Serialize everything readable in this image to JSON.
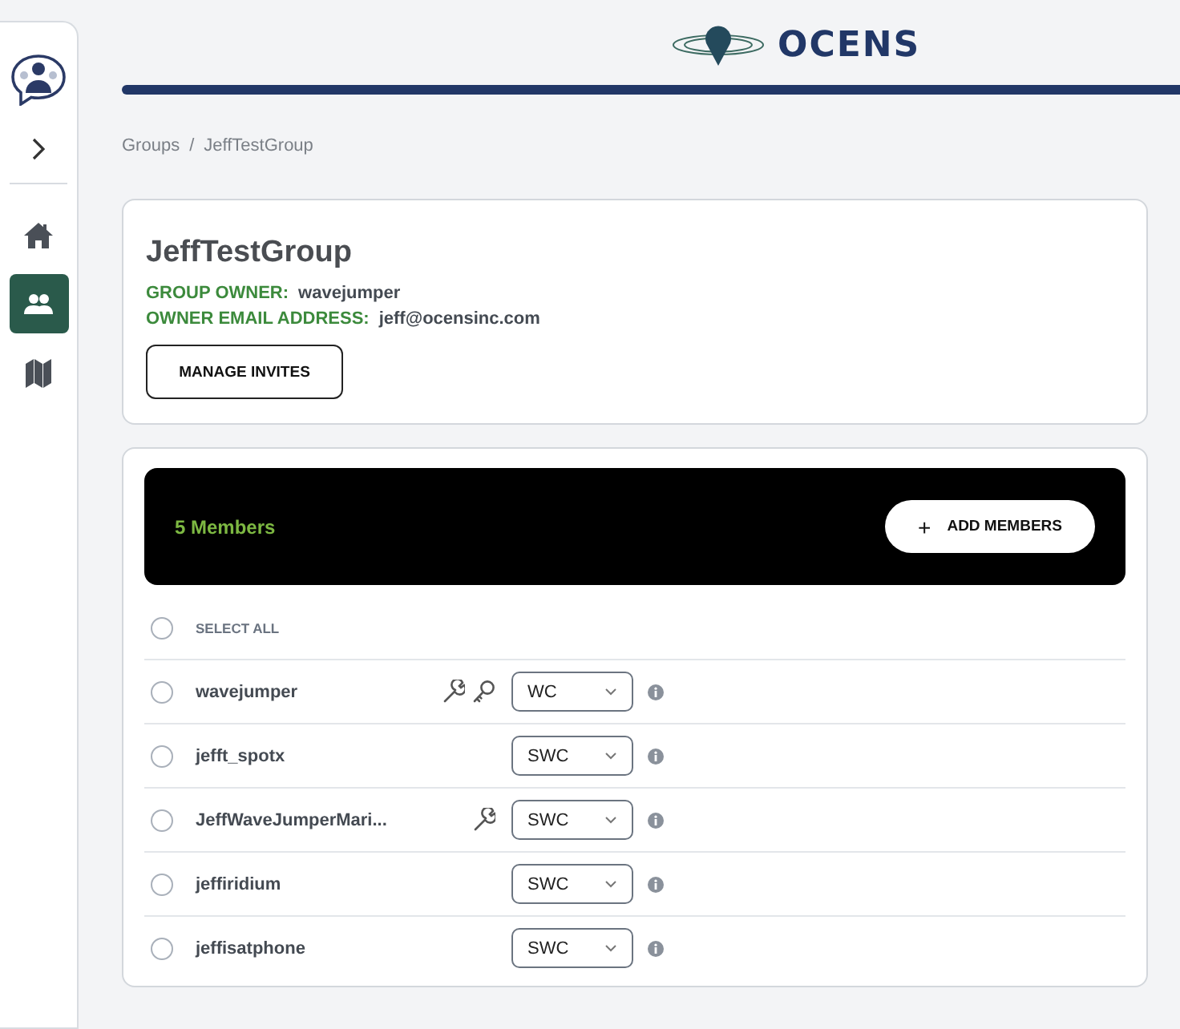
{
  "logo": {
    "text": "OCENS"
  },
  "sidebar": {
    "items": [
      {
        "kind": "home",
        "selected": false
      },
      {
        "kind": "groups",
        "selected": true
      },
      {
        "kind": "map",
        "selected": false
      }
    ]
  },
  "breadcrumb": [
    "Groups",
    "/",
    "JeffTestGroup"
  ],
  "group": {
    "name": "JeffTestGroup",
    "owner_label": "GROUP OWNER:",
    "owner": "wavejumper",
    "email_label": "OWNER EMAIL ADDRESS:",
    "email": "jeff@ocensinc.com",
    "button": "MANAGE INVITES"
  },
  "members_header": {
    "count": "5 Members",
    "add_icon": "+",
    "add_label": "ADD MEMBERS"
  },
  "select_all": {
    "label": "SELECT ALL",
    "selected": false
  },
  "members": [
    {
      "name": "wavejumper",
      "selected": false,
      "admin": true,
      "owner": true,
      "role": "WC"
    },
    {
      "name": "jefft_spotx",
      "selected": false,
      "admin": false,
      "owner": false,
      "role": "SWC"
    },
    {
      "name": "JeffWaveJumperMari...",
      "selected": false,
      "admin": true,
      "owner": false,
      "role": "SWC"
    },
    {
      "name": "jeffiridium",
      "selected": false,
      "admin": false,
      "owner": false,
      "role": "SWC"
    },
    {
      "name": "jeffisatphone",
      "selected": false,
      "admin": false,
      "owner": false,
      "role": "SWC"
    }
  ]
}
